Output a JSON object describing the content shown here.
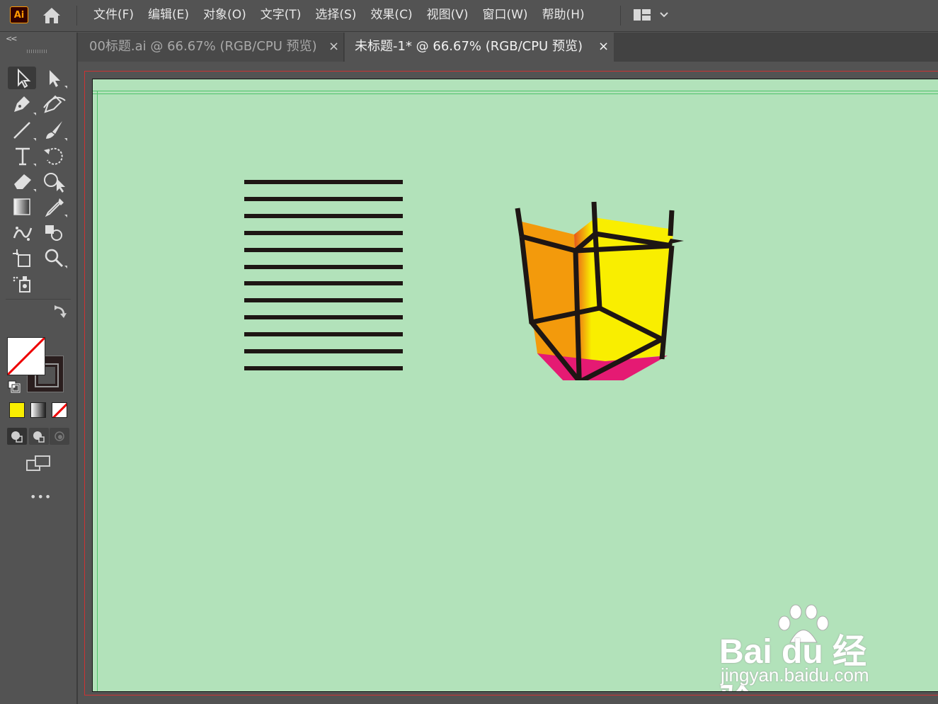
{
  "app": {
    "logo_text": "Ai"
  },
  "menu": [
    "文件(F)",
    "编辑(E)",
    "对象(O)",
    "文字(T)",
    "选择(S)",
    "效果(C)",
    "视图(V)",
    "窗口(W)",
    "帮助(H)"
  ],
  "tabs": [
    {
      "label": "00标题.ai @ 66.67% (RGB/CPU 预览)",
      "close": "×",
      "active": false
    },
    {
      "label": "未标题-1* @ 66.67% (RGB/CPU 预览)",
      "close": "×",
      "active": true
    }
  ],
  "toolbar": {
    "collapse": "<<",
    "tools": [
      "selection-tool",
      "direct-selection-tool",
      "pen-tool",
      "curvature-tool",
      "line-tool",
      "paintbrush-tool",
      "type-tool",
      "rotate-tool",
      "eraser-tool",
      "shape-builder-tool",
      "gradient-tool",
      "eyedropper-tool",
      "symbol-sprayer-tool",
      "blend-tool",
      "artboard-tool",
      "zoom-tool",
      "live-paint-tool"
    ],
    "more": "•••"
  },
  "colors": {
    "artboard": "#b2e2ba",
    "stroke": "#1e1614",
    "cube_left": "#f39a0c",
    "cube_right": "#f9ee00",
    "cube_bottom": "#e51a73",
    "gradient_start": "#e8551a",
    "fill_mode_color": "#f9ee00"
  },
  "artwork": {
    "horizontal_line_count": 12
  },
  "watermark": {
    "brand": "Bai du 经验",
    "url": "jingyan.baidu.com"
  }
}
